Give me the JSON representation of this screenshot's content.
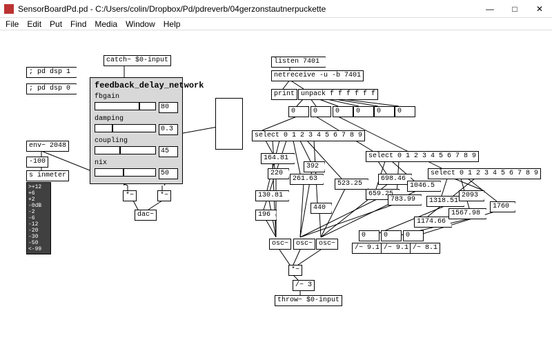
{
  "window": {
    "title": "SensorBoardPd.pd  - C:/Users/colin/Dropbox/Pd/pdreverb/04gerzonstautnerpuckette",
    "min": "—",
    "max": "□",
    "close": "✕"
  },
  "menu": {
    "file": "File",
    "edit": "Edit",
    "put": "Put",
    "find": "Find",
    "media": "Media",
    "window": "Window",
    "help": "Help"
  },
  "left": {
    "dsp1": "; pd dsp 1",
    "dsp0": "; pd dsp 0",
    "env": "env~ 2048",
    "n100": "-100",
    "sinmeter": "s inmeter",
    "vu": [
      ">+12",
      "+6",
      "+2",
      "-0dB",
      "-2",
      "-6",
      "-12",
      "-20",
      "-30",
      "-50",
      "<-99"
    ]
  },
  "catch": "catch~ $0-input",
  "gop": {
    "title": "feedback_delay_network",
    "rows": [
      {
        "label": "fbgain",
        "val": "80",
        "knob": 72
      },
      {
        "label": "damping",
        "val": "0.3",
        "knob": 28
      },
      {
        "label": "coupling",
        "val": "45",
        "knob": 40
      },
      {
        "label": "nix",
        "val": "50",
        "knob": 46
      }
    ]
  },
  "sigmul1": "*~",
  "sigmul2": "*~",
  "dac": "dac~",
  "right": {
    "listen": "listen 7401",
    "netreceive": "netreceive -u -b 7401",
    "print": "print",
    "unpack": "unpack f f f f f f",
    "zeros": [
      "0",
      "0",
      "0",
      "0",
      "0",
      "0"
    ],
    "select1": "select 0 1 2 3 4 5 6 7 8 9",
    "select2": "select 0 1 2 3 4 5 6 7 8 9",
    "select3": "select 0 1 2 3 4 5 6 7 8 9",
    "vals1": [
      "164.81",
      "220",
      "130.81",
      "196"
    ],
    "vals2": [
      "392",
      "261.63",
      "523.25",
      "440"
    ],
    "vals3": [
      "698.46",
      "659.25",
      "1046.5",
      "783.99"
    ],
    "vals4": [
      "1318.51",
      "1174.66",
      "2093",
      "1567.98",
      "1760"
    ],
    "lowzeros": [
      "0",
      "0",
      "0"
    ],
    "osc": [
      "osc~",
      "osc~",
      "osc~"
    ],
    "div": [
      "/~ 9.1",
      "/~ 9.1",
      "/~ 8.1"
    ],
    "sigmul": "*~",
    "div3": "/~ 3",
    "throw": "throw~ $0-input"
  }
}
